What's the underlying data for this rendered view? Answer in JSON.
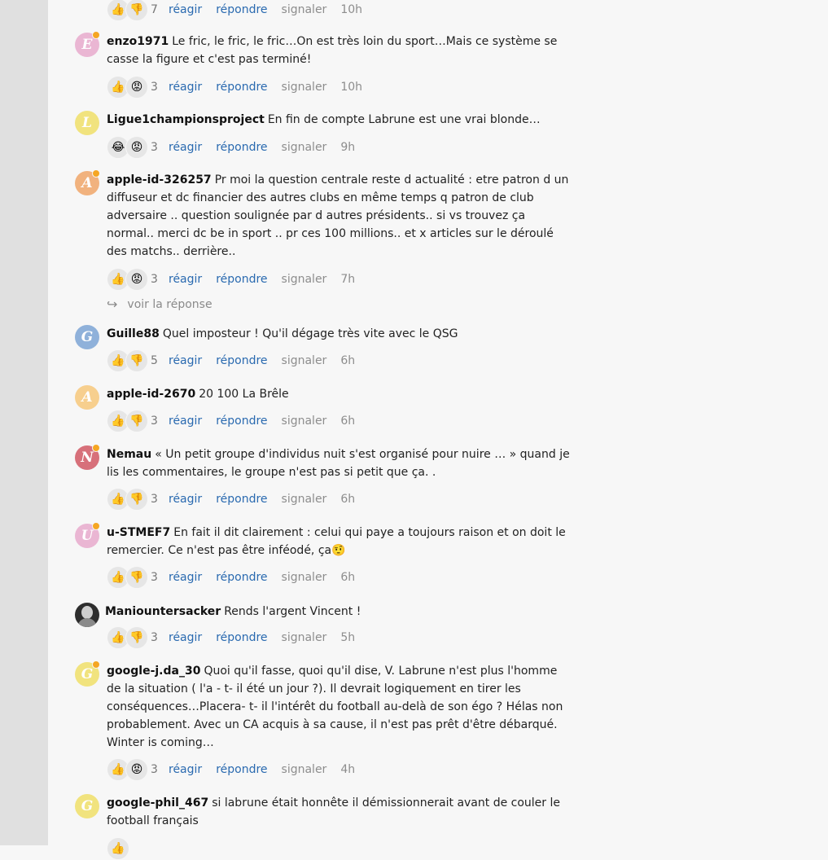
{
  "labels": {
    "react": "réagir",
    "reply": "répondre",
    "report": "signaler",
    "see_reply": "voir la réponse"
  },
  "top_bar": {
    "reactions": [
      "like",
      "dislike"
    ],
    "count": "7",
    "time": "10h"
  },
  "comments": [
    {
      "username": "enzo1971",
      "initial": "E",
      "avatar_color": "#eab6d3",
      "text": "Le fric, le fric, le fric…On est très loin du sport…Mais ce système se casse la figure et c'est pas terminé!",
      "reactions": [
        "like",
        "angry"
      ],
      "count": "3",
      "time": "10h"
    },
    {
      "username": "Ligue1championsproject",
      "initial": "L",
      "avatar_color": "#f1e37e",
      "text": "En fin de compte Labrune est une vrai blonde…",
      "reactions": [
        "laugh",
        "angry"
      ],
      "count": "3",
      "time": "9h"
    },
    {
      "username": "apple-id-326257",
      "initial": "A",
      "avatar_color": "#f1b27e",
      "text": "Pr moi la question centrale reste d actualité : etre patron d un diffuseur et dc financier des autres clubs en même temps q patron de club adversaire .. question soulignée par d autres présidents.. si vs trouvez ça normal.. merci dc be in sport .. pr ces 100 millions.. et x articles sur le déroulé des matchs.. derrière..",
      "reactions": [
        "like",
        "angry"
      ],
      "count": "3",
      "time": "7h"
    },
    {
      "username": "Guille88",
      "initial": "G",
      "avatar_color": "#8fb1da",
      "text": "Quel imposteur ! Qu'il dégage très vite avec le QSG",
      "reactions": [
        "like",
        "dislike"
      ],
      "count": "5",
      "time": "6h"
    },
    {
      "username": "apple-id-2670",
      "initial": "A",
      "avatar_color": "#f7cf8e",
      "text": "20 100 La Brêle",
      "reactions": [
        "like",
        "dislike"
      ],
      "count": "3",
      "time": "6h"
    },
    {
      "username": "Nemau",
      "initial": "N",
      "avatar_color": "#d7707a",
      "text": "« Un petit groupe d'individus nuit s'est organisé pour nuire … » quand je lis les commentaires, le groupe n'est pas si petit que ça. .",
      "reactions": [
        "like",
        "dislike"
      ],
      "count": "3",
      "time": "6h"
    },
    {
      "username": "u-STMEF7",
      "initial": "U",
      "avatar_color": "#eab6d3",
      "text": "En fait il dit clairement : celui qui paye a toujours raison et on doit le remercier. Ce n'est pas être inféodé, ça🤨",
      "reactions": [
        "like",
        "dislike"
      ],
      "count": "3",
      "time": "6h"
    },
    {
      "username": "Maniountersacker",
      "initial": "",
      "avatar_color": "#2e2e2e",
      "text": "Rends l'argent Vincent !",
      "reactions": [
        "like",
        "dislike"
      ],
      "count": "3",
      "time": "5h"
    },
    {
      "username": "google-j.da_30",
      "initial": "G",
      "avatar_color": "#f1e37e",
      "text": "Quoi qu'il fasse, quoi qu'il dise, V. Labrune n'est plus l'homme de la situation ( l'a - t- il été un jour ?). Il devrait logiquement en tirer les conséquences…Placera- t- il l'intérêt du football au-delà de son égo ? Hélas non probablement. Avec un CA acquis à sa cause, il n'est pas prêt d'être débarqué. Winter is coming…",
      "reactions": [
        "like",
        "angry"
      ],
      "count": "3",
      "time": "4h"
    },
    {
      "username": "google-phil_467",
      "initial": "G",
      "avatar_color": "#f1e37e",
      "text": "si labrune était honnête il démissionnerait avant de couler le football français",
      "reactions": [
        "like"
      ],
      "count": "",
      "time": ""
    }
  ],
  "reaction_icons": {
    "like": "👍",
    "dislike": "👎",
    "angry": "😡",
    "laugh": "😂"
  }
}
